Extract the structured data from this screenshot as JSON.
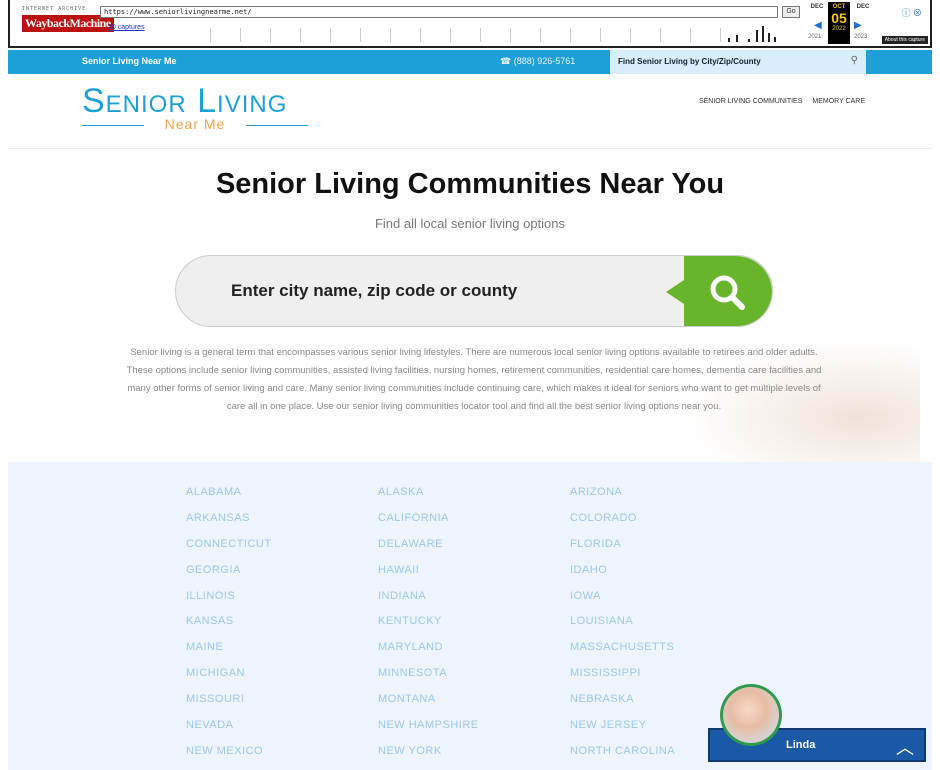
{
  "wayback": {
    "logo_top": "INTERNET ARCHIVE",
    "logo_main": "WaybackMachine",
    "url": "https://www.seniorlivingnearme.net/",
    "go_label": "Go",
    "captures": "30 captures",
    "range": "",
    "months": {
      "prev": "DEC",
      "current": "OCT",
      "next": "DEC"
    },
    "day": "05",
    "years": {
      "prev": "2021",
      "current": "2022",
      "next": "2023"
    },
    "about": "About this capture"
  },
  "topbar": {
    "brand": "Senior Living Near Me",
    "phone": "(888) 926-5761",
    "search_label": "Find Senior Living by City/Zip/County"
  },
  "logo": {
    "main": "Senior Living",
    "sub": "Near Me"
  },
  "nav": {
    "items": [
      "SENIOR LIVING COMMUNITIES",
      "MEMORY CARE"
    ]
  },
  "hero": {
    "title": "Senior Living Communities Near You",
    "subtitle": "Find all local senior living options",
    "search_placeholder": "Enter city name, zip code or county"
  },
  "intro": "Senior living is a general term that encompasses various senior living lifestyles. There are numerous local senior living options available to retirees and older adults. These options include senior living communities, assisted living facilities, nursing homes, retirement communities, residential care homes, dementia care facilities and many other forms of senior living and care. Many senior living communities include continuing care, which makes it ideal for seniors who want to get multiple levels of care all in one place. Use our senior living communities locator tool and find all the best senior living options near you.",
  "states": {
    "col1": [
      "ALABAMA",
      "ARKANSAS",
      "CONNECTICUT",
      "GEORGIA",
      "ILLINOIS",
      "KANSAS",
      "MAINE",
      "MICHIGAN",
      "MISSOURI",
      "NEVADA",
      "NEW MEXICO"
    ],
    "col2": [
      "ALASKA",
      "CALIFORNIA",
      "DELAWARE",
      "HAWAII",
      "INDIANA",
      "KENTUCKY",
      "MARYLAND",
      "MINNESOTA",
      "MONTANA",
      "NEW HAMPSHIRE",
      "NEW YORK"
    ],
    "col3": [
      "ARIZONA",
      "COLORADO",
      "FLORIDA",
      "IDAHO",
      "IOWA",
      "LOUISIANA",
      "MASSACHUSETTS",
      "MISSISSIPPI",
      "NEBRASKA",
      "NEW JERSEY",
      "NORTH CAROLINA"
    ]
  },
  "chat": {
    "name": "Linda"
  }
}
